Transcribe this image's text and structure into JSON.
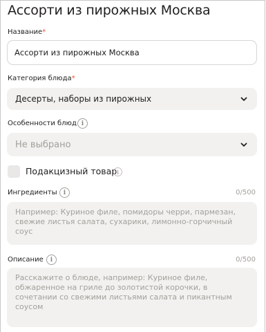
{
  "form": {
    "title": "Ассорти из пирожных Москва",
    "name": {
      "label": "Название",
      "required_mark": "*",
      "value": "Ассорти из пирожных Москва"
    },
    "category": {
      "label": "Категория блюда",
      "required_mark": "*",
      "value": "Десерты, наборы из пирожных"
    },
    "features": {
      "label": "Особенности блюд",
      "info_icon": "info-icon",
      "value": "Не выбрано"
    },
    "excise": {
      "label": "Подакцизный товар",
      "checked": false,
      "info_icon": "info-icon"
    },
    "ingredients": {
      "label": "Ингредиенты",
      "counter": "0/500",
      "placeholder": "Например:  Куриное филе, помидоры черри, пармезан, свежие листья салата, сухарики, лимонно-горчичный соус"
    },
    "description": {
      "label": "Описание",
      "counter": "0/500",
      "placeholder": "Расскажите о блюде, например: Куриное филе, обжаренное на гриле до золотистой корочки, в сочетании со свежими листьями салата и пикантным соусом"
    }
  }
}
